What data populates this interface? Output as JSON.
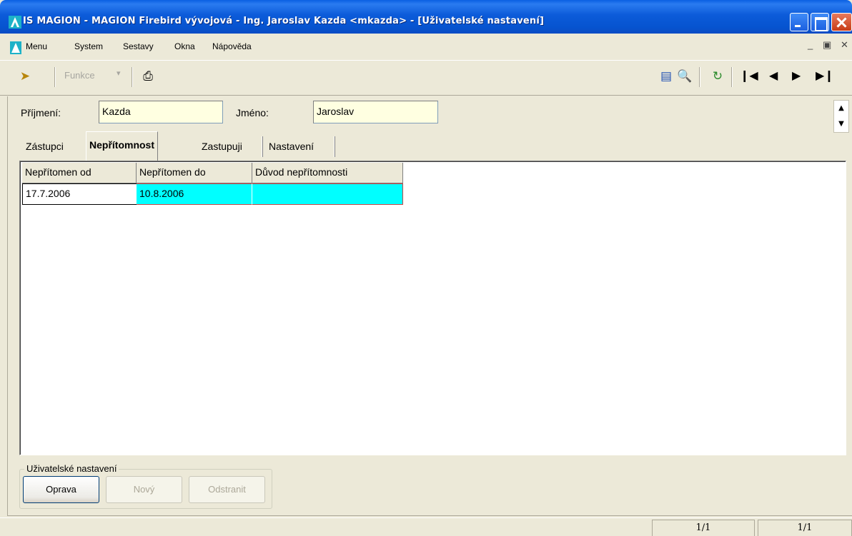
{
  "window": {
    "title": "IS MAGION - MAGION Firebird vývojová - Ing. Jaroslav Kazda <mkazda> - [Uživatelské nastavení]"
  },
  "menu": {
    "items": [
      "Menu",
      "System",
      "Sestavy",
      "Okna",
      "Nápověda"
    ]
  },
  "toolbar": {
    "funkce_label": "Funkce"
  },
  "form": {
    "surname_label": "Příjmení:",
    "surname_value": "Kazda",
    "name_label": "Jméno:",
    "name_value": "Jaroslav"
  },
  "tabs": [
    {
      "label": "Zástupci",
      "active": false
    },
    {
      "label": "Nepřítomnost",
      "active": true
    },
    {
      "label": "Zastupuji",
      "active": false
    },
    {
      "label": "Nastavení",
      "active": false
    }
  ],
  "grid": {
    "columns": [
      "Nepřítomen od",
      "Nepřítomen do",
      "Důvod nepřítomnosti"
    ],
    "rows": [
      [
        "17.7.2006",
        "10.8.2006",
        ""
      ]
    ],
    "selected_color": "#00ffff"
  },
  "group": {
    "title": "Uživatelské nastavení",
    "buttons": [
      {
        "label": "Oprava",
        "enabled": true
      },
      {
        "label": "Nový",
        "enabled": false
      },
      {
        "label": "Odstranit",
        "enabled": false
      }
    ]
  },
  "status": {
    "cell1": "1/1",
    "cell2": "1/1"
  }
}
